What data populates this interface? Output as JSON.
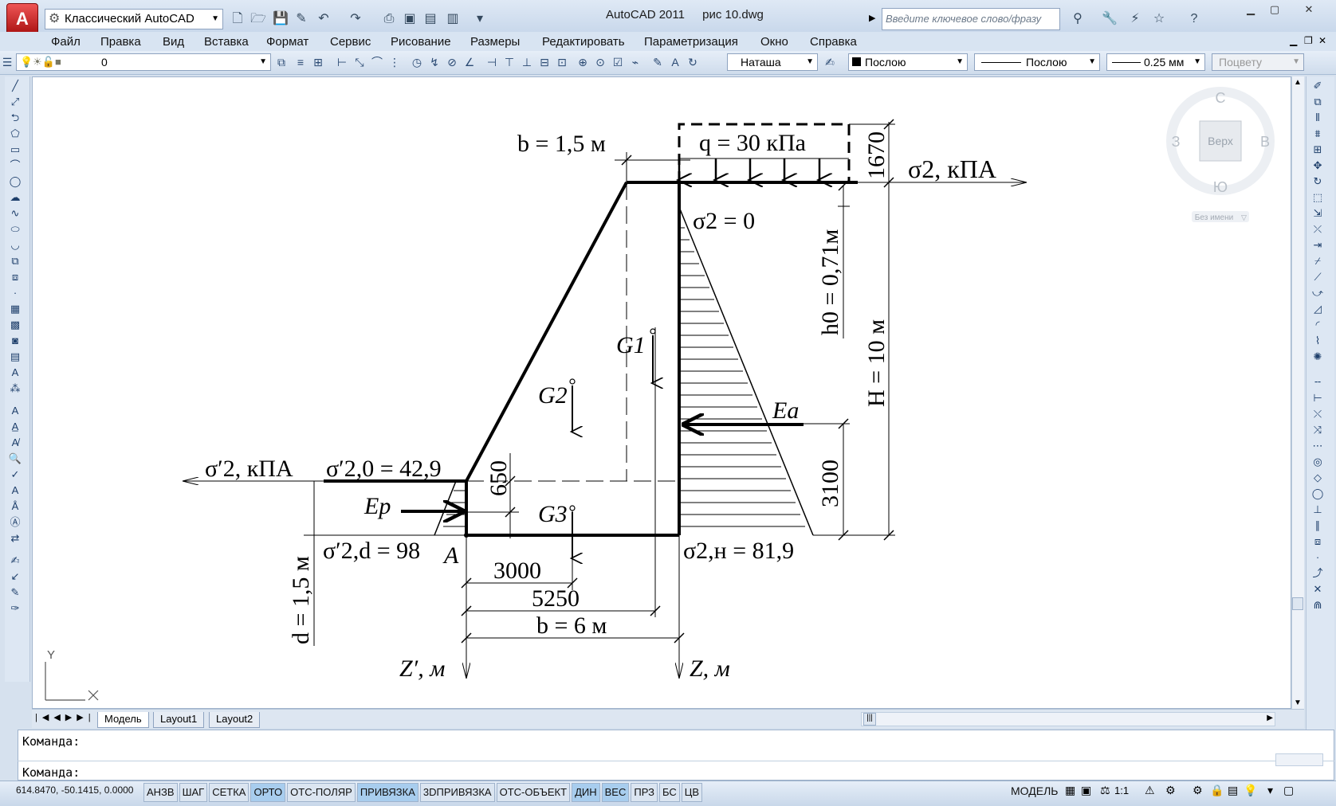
{
  "app": {
    "workspace": "Классический AutoCAD",
    "title": "AutoCAD 2011",
    "filename": "рис 10.dwg",
    "search_placeholder": "Введите ключевое слово/фразу"
  },
  "menu": [
    "Файл",
    "Правка",
    "Вид",
    "Вставка",
    "Формат",
    "Сервис",
    "Рисование",
    "Размеры",
    "Редактировать",
    "Параметризация",
    "Окно",
    "Справка"
  ],
  "layers": {
    "current_layer": "0",
    "text_style": "Наташа",
    "color": "Послою",
    "linetype": "Послою",
    "lineweight": "0.25 мм",
    "plotstyle": "Поцвету"
  },
  "viewcube": {
    "north": "С",
    "south": "Ю",
    "west": "З",
    "east": "В",
    "face": "Верх",
    "ucs_name": "Без имени"
  },
  "ucs_icon": {
    "y_label": "Y"
  },
  "drawing": {
    "b_top": "b = 1,5 м",
    "q_load": "q = 30 кПа",
    "dim_1670": "1670",
    "sigma_axis": "σ2, кПА",
    "sigma_top": "σ2 = 0",
    "h0": "h0 = 0,71м",
    "H": "H = 10 м",
    "G1": "G1",
    "G2": "G2",
    "G3": "G3",
    "Ea": "Ea",
    "Ep": "Ep",
    "dim_3100": "3100",
    "dim_650": "650",
    "sigma_prime_axis": "σ′2, кПА",
    "sigma_prime_0": "σ′2,0 = 42,9",
    "sigma_prime_d": "σ′2,d = 98",
    "point_A": "A",
    "sigma_bottom": "σ2,н = 81,9",
    "dim_3000": "3000",
    "dim_5250": "5250",
    "b_bottom": "b = 6 м",
    "d_depth": "d = 1,5 м",
    "z_prime": "Z′, м",
    "z_axis": "Z, м"
  },
  "tabs": [
    "Модель",
    "Layout1",
    "Layout2"
  ],
  "command": {
    "line1": "Команда:",
    "line2": "Команда:"
  },
  "status": {
    "coords": "614.8470, -50.1415, 0.0000",
    "buttons": [
      {
        "label": "АНЗВ",
        "on": false
      },
      {
        "label": "ШАГ",
        "on": false
      },
      {
        "label": "СЕТКА",
        "on": false
      },
      {
        "label": "ОРТО",
        "on": true
      },
      {
        "label": "ОТС-ПОЛЯР",
        "on": false
      },
      {
        "label": "ПРИВЯЗКА",
        "on": true
      },
      {
        "label": "3DПРИВЯЗКА",
        "on": false
      },
      {
        "label": "ОТС-ОБЪЕКТ",
        "on": false
      },
      {
        "label": "ДИН",
        "on": true
      },
      {
        "label": "ВЕС",
        "on": true
      },
      {
        "label": "ПРЗ",
        "on": false
      },
      {
        "label": "БС",
        "on": false
      },
      {
        "label": "ЦВ",
        "on": false
      }
    ],
    "model": "МОДЕЛЬ",
    "scale": "1:1"
  }
}
